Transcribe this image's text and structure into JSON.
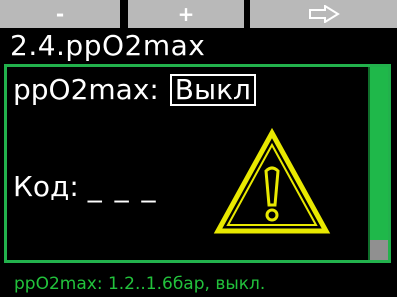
{
  "softkeys": {
    "left_label": "-",
    "middle_label": "+",
    "right_icon": "arrow-right-outline-icon"
  },
  "title": "2.4.ppO2max",
  "setting": {
    "label": "ppO2max:",
    "value": "Выкл"
  },
  "code": {
    "label": "Код:",
    "value": "_ _ _"
  },
  "warning_icon": "warning-triangle-icon",
  "footer": "ppO2max: 1.2..1.6бар, выкл.",
  "colors": {
    "accent": "#22b14c",
    "warning": "#e8e800",
    "softkey_bg": "#b9b9b9"
  }
}
